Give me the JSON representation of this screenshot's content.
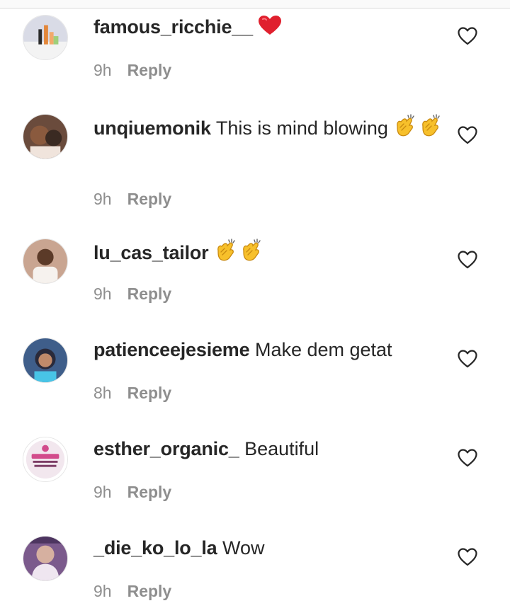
{
  "comments": [
    {
      "username": "famous_ricchie__",
      "text": "",
      "emoji": [
        "heart"
      ],
      "time": "9h",
      "reply_label": "Reply",
      "avatar_bg": "#d9dbe6"
    },
    {
      "username": "unqiuemonik",
      "text": "This is mind blowing",
      "emoji": [
        "clap",
        "clap"
      ],
      "time": "9h",
      "reply_label": "Reply",
      "avatar_bg": "#6a4b3c"
    },
    {
      "username": "lu_cas_tailor",
      "text": "",
      "emoji": [
        "clap",
        "clap"
      ],
      "time": "9h",
      "reply_label": "Reply",
      "avatar_bg": "#c9a591"
    },
    {
      "username": "patienceejesieme",
      "text": "Make dem getat",
      "emoji": [],
      "time": "8h",
      "reply_label": "Reply",
      "avatar_bg": "#3f5e8a"
    },
    {
      "username": "esther_organic_",
      "text": "Beautiful",
      "emoji": [],
      "time": "9h",
      "reply_label": "Reply",
      "avatar_bg": "#f2e7ee"
    },
    {
      "username": "_die_ko_lo_la",
      "text": "Wow",
      "emoji": [],
      "time": "9h",
      "reply_label": "Reply",
      "avatar_bg": "#7b5a8c"
    }
  ],
  "colors": {
    "text": "#262626",
    "muted": "#8e8e8e",
    "heart_red": "#e0202e",
    "clap_yellow": "#f7c02b"
  },
  "icons": {
    "like": "heart-outline-icon",
    "heart_emoji": "red-heart-emoji",
    "clap_emoji": "clapping-hands-emoji"
  }
}
